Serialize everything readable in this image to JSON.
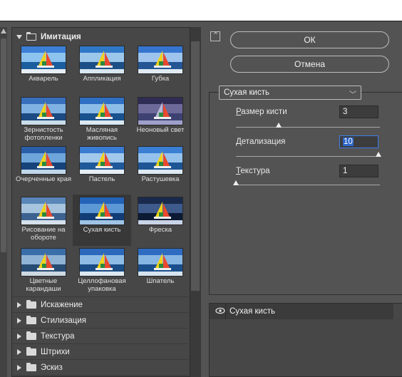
{
  "categories": {
    "open": {
      "label": "Имитация"
    },
    "collapsed": [
      {
        "label": "Искажение"
      },
      {
        "label": "Стилизация"
      },
      {
        "label": "Текстура"
      },
      {
        "label": "Штрихи"
      },
      {
        "label": "Эскиз"
      }
    ]
  },
  "filters": [
    {
      "label": "Акварель",
      "icon": "watercolor-thumbnail"
    },
    {
      "label": "Аппликация",
      "icon": "cutout-thumbnail"
    },
    {
      "label": "Губка",
      "icon": "sponge-thumbnail"
    },
    {
      "label": "Зернистость фотопленки",
      "icon": "film-grain-thumbnail"
    },
    {
      "label": "Масляная живопись",
      "icon": "paint-daubs-thumbnail"
    },
    {
      "label": "Неоновый свет",
      "icon": "neon-glow-thumbnail"
    },
    {
      "label": "Очерченные края",
      "icon": "poster-edges-thumbnail"
    },
    {
      "label": "Пастель",
      "icon": "rough-pastels-thumbnail"
    },
    {
      "label": "Растушевка",
      "icon": "smudge-stick-thumbnail"
    },
    {
      "label": "Рисование на обороте",
      "icon": "underpainting-thumbnail"
    },
    {
      "label": "Сухая кисть",
      "icon": "dry-brush-thumbnail"
    },
    {
      "label": "Фреска",
      "icon": "fresco-thumbnail"
    },
    {
      "label": "Цветные карандаши",
      "icon": "colored-pencil-thumbnail"
    },
    {
      "label": "Целлофановая упаковка",
      "icon": "plastic-wrap-thumbnail"
    },
    {
      "label": "Шпатель",
      "icon": "palette-knife-thumbnail"
    }
  ],
  "selected_filter": "Сухая кисть",
  "buttons": {
    "ok": "ОК",
    "cancel": "Отмена"
  },
  "filter_select": {
    "value": "Сухая кисть"
  },
  "params": [
    {
      "label": "Размер кисти",
      "value": "3",
      "level": 0.3
    },
    {
      "label": "Детализация",
      "value": "10",
      "level": 1.0
    },
    {
      "label": "Текстура",
      "value": "1",
      "level": 0.0
    }
  ],
  "layer": {
    "label": "Сухая кисть"
  },
  "colors": {
    "panel": "#535353",
    "gallery": "#474747",
    "accent": "#3f7ee8",
    "selected_cell": "#383838"
  }
}
